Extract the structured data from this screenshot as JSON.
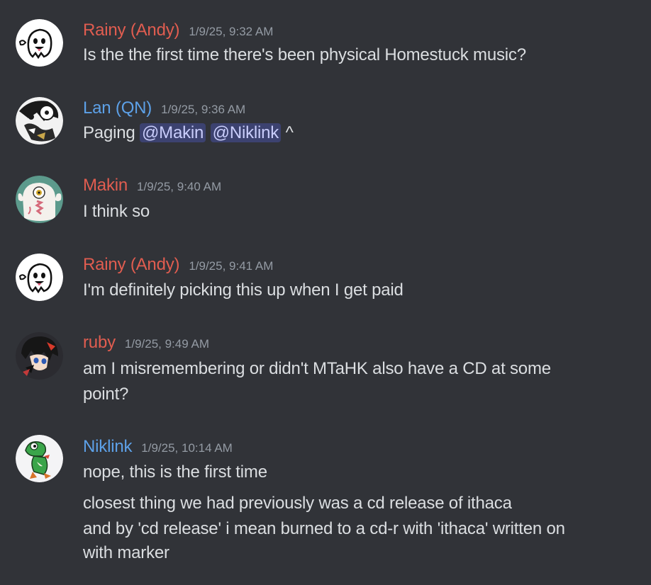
{
  "colors": {
    "background": "#313338",
    "name_red": "#e15d50",
    "name_blue": "#5da1e8",
    "timestamp": "#949ba4",
    "text": "#dbdee1",
    "mention_bg": "#3c4270",
    "mention_text": "#c9cdfb"
  },
  "messages": [
    {
      "author": "Rainy (Andy)",
      "timestamp": "1/9/25, 9:32 AM",
      "avatar_icon": "white-ghost-avatar",
      "lines": [
        "Is the the first time there's been physical Homestuck music?"
      ]
    },
    {
      "author": "Lan (QN)",
      "timestamp": "1/9/25, 9:36 AM",
      "avatar_icon": "black-white-character-avatar",
      "text_before": "Paging ",
      "mentions": [
        "@Makin",
        "@Niklink"
      ],
      "text_after": " ^"
    },
    {
      "author": "Makin",
      "timestamp": "1/9/25, 9:40 AM",
      "avatar_icon": "white-creature-avatar",
      "lines": [
        "I think so"
      ]
    },
    {
      "author": "Rainy (Andy)",
      "timestamp": "1/9/25, 9:41 AM",
      "avatar_icon": "white-ghost-avatar",
      "lines": [
        "I'm definitely picking this up when I get  paid"
      ]
    },
    {
      "author": "ruby",
      "timestamp": "1/9/25, 9:49 AM",
      "avatar_icon": "anime-character-avatar",
      "lines": [
        "am I misremembering or didn't MTaHK also have a CD at some",
        "point?"
      ]
    },
    {
      "author": "Niklink",
      "timestamp": "1/9/25, 10:14 AM",
      "avatar_icon": "green-dinosaur-avatar",
      "lines": [
        "nope, this is the first time"
      ],
      "followup_lines": [
        "closest thing we had previously was a cd release of ithaca",
        "and by 'cd release' i mean burned to a cd-r with 'ithaca' written on",
        "with marker"
      ]
    }
  ]
}
